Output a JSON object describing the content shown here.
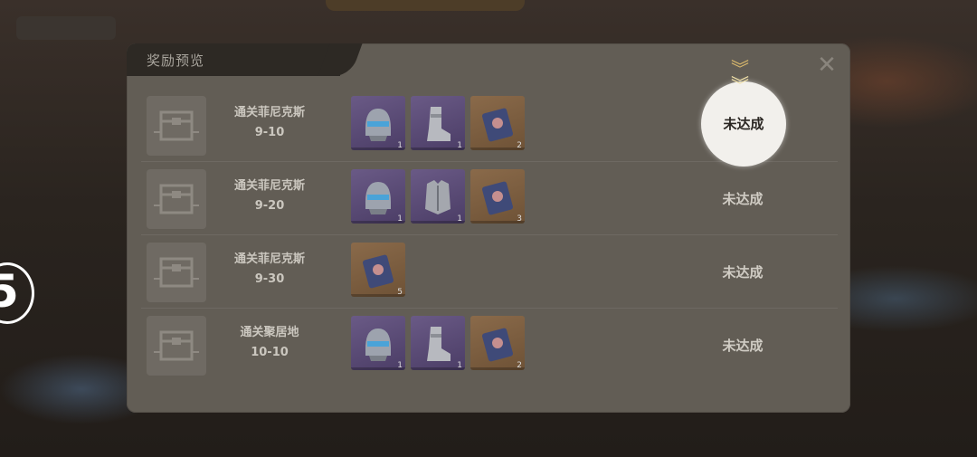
{
  "modal": {
    "title": "奖励预览",
    "close_icon": "close-icon"
  },
  "rows": [
    {
      "stage_name": "通关菲尼克斯",
      "stage_level": "9-10",
      "status": "未达成",
      "items": [
        {
          "icon": "helmet-icon",
          "rarity": "purple",
          "count": "1"
        },
        {
          "icon": "boots-icon",
          "rarity": "purple",
          "count": "1"
        },
        {
          "icon": "card-icon",
          "rarity": "orange",
          "count": "2"
        }
      ]
    },
    {
      "stage_name": "通关菲尼克斯",
      "stage_level": "9-20",
      "status": "未达成",
      "items": [
        {
          "icon": "helmet-icon",
          "rarity": "purple",
          "count": "1"
        },
        {
          "icon": "armor-icon",
          "rarity": "purple",
          "count": "1"
        },
        {
          "icon": "card-icon",
          "rarity": "orange",
          "count": "3"
        }
      ]
    },
    {
      "stage_name": "通关菲尼克斯",
      "stage_level": "9-30",
      "status": "未达成",
      "items": [
        {
          "icon": "card-icon",
          "rarity": "orange",
          "count": "5"
        }
      ]
    },
    {
      "stage_name": "通关聚居地",
      "stage_level": "10-10",
      "status": "未达成",
      "items": [
        {
          "icon": "helmet-icon",
          "rarity": "purple",
          "count": "1"
        },
        {
          "icon": "boots-icon",
          "rarity": "purple",
          "count": "1"
        },
        {
          "icon": "card-icon",
          "rarity": "orange",
          "count": "2"
        }
      ]
    }
  ],
  "background": {
    "level_badge": "5"
  },
  "colors": {
    "panel": "#625d55",
    "purple_rarity": "#5a4a78",
    "orange_rarity": "#7c5e40",
    "accent": "#d9b86c"
  }
}
